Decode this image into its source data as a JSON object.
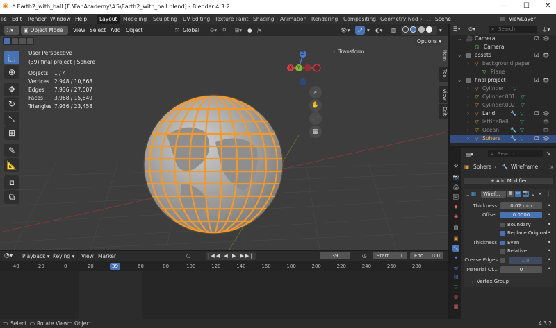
{
  "titlebar": {
    "title": "* Earth2_with_ball [E:\\FabAcademy\\#5\\Earth2_with_ball.blend] - Blender 4.3.2",
    "minimize": "—",
    "maximize": "☐",
    "close": "✕"
  },
  "menu": {
    "file": "ile",
    "edit": "Edit",
    "render": "Render",
    "window": "Window",
    "help": "Help"
  },
  "workspaces": [
    "Layout",
    "Modeling",
    "Sculpting",
    "UV Editing",
    "Texture Paint",
    "Shading",
    "Animation",
    "Rendering",
    "Compositing",
    "Geometry Nod"
  ],
  "scene": {
    "scene_label": "Scene",
    "viewlayer_label": "ViewLayer"
  },
  "viewport_header": {
    "mode": "Object Mode",
    "view": "View",
    "select": "Select",
    "add": "Add",
    "object": "Object",
    "orientation": "Global",
    "options": "Options"
  },
  "overlay_text": {
    "perspective": "User Perspective",
    "context": "(39) final project | Sphere"
  },
  "stats": [
    {
      "label": "Objects",
      "value": "1 / 4"
    },
    {
      "label": "Vertices",
      "value": "2,948 / 10,668"
    },
    {
      "label": "Edges",
      "value": "7,936 / 27,507"
    },
    {
      "label": "Faces",
      "value": "3,968 / 15,849"
    },
    {
      "label": "Triangles",
      "value": "7,936 / 23,458"
    }
  ],
  "gizmo": {
    "x": "X",
    "y": "Y",
    "z": "Z"
  },
  "sidebar": {
    "transform": "Transform",
    "tab_item": "Item",
    "tab_tool": "Tool",
    "tab_view": "View",
    "tab_edit": "Edit"
  },
  "timeline": {
    "playback": "Playback",
    "keying": "Keying",
    "view": "View",
    "marker": "Marker",
    "current_frame": "39",
    "start_label": "Start",
    "start": "1",
    "end_label": "End",
    "end": "100",
    "ticks": [
      "-40",
      "-20",
      "0",
      "20",
      "40",
      "60",
      "80",
      "100",
      "120",
      "140",
      "160",
      "180",
      "200",
      "220",
      "240",
      "260",
      "280"
    ],
    "playhead": "39"
  },
  "statusbar": {
    "select": "Select",
    "rotate": "Rotate View",
    "object": "Object",
    "version": "4.3.2"
  },
  "outliner": {
    "search_placeholder": "Search",
    "rows": [
      "Camera",
      "Camera",
      "assets",
      "background paper",
      "Plane",
      "final project",
      "Cylinder",
      "Cylinder.001",
      "Cylinder.002",
      "Land",
      "latticeBall",
      "Ocean",
      "Sphere"
    ]
  },
  "properties": {
    "search_placeholder": "Search",
    "object": "Sphere",
    "modifier_crumb": "Wireframe",
    "add_modifier": "Add Modifier",
    "modifier_name": "Wiref...",
    "thickness_label": "Thickness",
    "thickness": "0.02 mm",
    "offset_label": "Offset",
    "offset": "0.0000",
    "boundary": "Boundary",
    "replace_original": "Replace Original",
    "thickness2_label": "Thickness",
    "even": "Even",
    "relative": "Relative",
    "crease_label": "Crease Edges",
    "crease": "1.0",
    "material_label": "Material Of...",
    "material": "0",
    "vertex_group": "Vertex Group"
  },
  "colors": {
    "accent": "#4772b3",
    "selection": "#f59a2a",
    "viewport_bg": "#3d3d3d"
  }
}
